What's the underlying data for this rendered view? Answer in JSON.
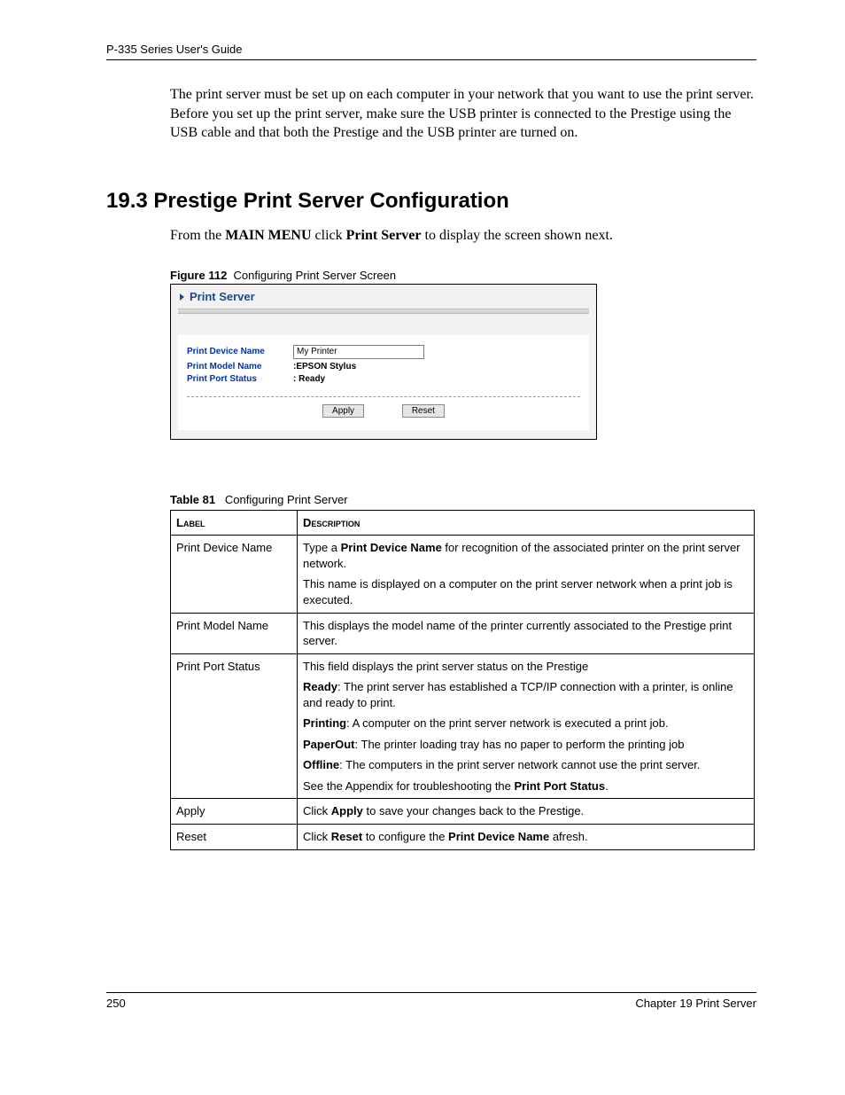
{
  "header": "P-335 Series User's Guide",
  "intro": "The print server must be set up on each computer in your network that you want to use the print server. Before you set up the print server, make sure the USB printer is connected to the Prestige using the USB cable and that both the Prestige and the USB printer are turned on.",
  "section_heading": "19.3  Prestige Print Server Configuration",
  "sub_line_pre": "From the ",
  "sub_line_bold1": "MAIN MENU",
  "sub_line_mid": " click ",
  "sub_line_bold2": "Print Server",
  "sub_line_post": " to display the screen shown next.",
  "figure_label": "Figure 112",
  "figure_caption": "Configuring Print Server Screen",
  "screenshot": {
    "title": "Print Server",
    "rows": {
      "device_label": "Print Device Name",
      "device_value": "My Printer",
      "model_label": "Print Model Name",
      "model_value": ":EPSON Stylus",
      "port_label": "Print Port Status",
      "port_value": ": Ready"
    },
    "apply": "Apply",
    "reset": "Reset"
  },
  "table_label": "Table 81",
  "table_caption": "Configuring Print Server",
  "table": {
    "h1": "Label",
    "h2": "Description",
    "r1_label": "Print Device Name",
    "r1_p1_a": "Type a ",
    "r1_p1_b": "Print Device Name",
    "r1_p1_c": " for recognition of the associated printer on the print server network.",
    "r1_p2": "This name is displayed on a computer on the print server network when a print job is executed.",
    "r2_label": "Print Model Name",
    "r2_p1": "This displays the model name of the printer currently associated to the Prestige print server.",
    "r3_label": "Print Port Status",
    "r3_p1": "This field displays the print server status on the Prestige",
    "r3_p2_b": "Ready",
    "r3_p2_t": ": The print server has established a TCP/IP connection with a printer, is online and ready to print.",
    "r3_p3_b": "Printing",
    "r3_p3_t": ": A computer on the print server network is executed a print job.",
    "r3_p4_b": "PaperOut",
    "r3_p4_t": ": The printer loading tray has no paper to perform the printing job",
    "r3_p5_b": "Offline",
    "r3_p5_t": ": The computers in the print server network cannot use the print server.",
    "r3_p6_a": "See the Appendix for troubleshooting the ",
    "r3_p6_b": "Print Port Status",
    "r3_p6_c": ".",
    "r4_label": "Apply",
    "r4_p1_a": "Click ",
    "r4_p1_b": "Apply",
    "r4_p1_c": " to save your changes back to the Prestige.",
    "r5_label": "Reset",
    "r5_p1_a": "Click ",
    "r5_p1_b": "Reset",
    "r5_p1_c": " to configure the ",
    "r5_p1_d": "Print Device Name",
    "r5_p1_e": " afresh."
  },
  "footer_left": "250",
  "footer_right": "Chapter 19 Print Server"
}
